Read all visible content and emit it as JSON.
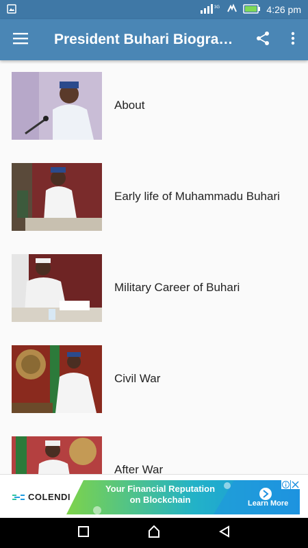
{
  "status_bar": {
    "time": "4:26 pm",
    "network": "3G",
    "icons": [
      "image-icon",
      "signal-icon",
      "charging-icon",
      "battery-icon"
    ]
  },
  "app_bar": {
    "title": "President Buhari Biograp...",
    "icons": [
      "menu-icon",
      "share-icon",
      "more-vert-icon"
    ]
  },
  "list": {
    "items": [
      {
        "label": "About"
      },
      {
        "label": "Early life of Muhammadu Buhari"
      },
      {
        "label": "Military Career of Buhari"
      },
      {
        "label": "Civil War"
      },
      {
        "label": "After War"
      }
    ]
  },
  "ad": {
    "brand": "COLENDI",
    "headline_line1": "Your Financial Reputation",
    "headline_line2": "on Blockchain",
    "cta": "Learn More",
    "colors": {
      "green": "#6fcf3a",
      "blue": "#1e9be0",
      "navy": "#0b2a5b"
    }
  },
  "nav_bar": {
    "icons": [
      "recents-square-icon",
      "home-icon",
      "back-triangle-icon"
    ]
  },
  "colors": {
    "status_bar": "#3f78a6",
    "app_bar": "#4a86b5",
    "background": "#fafafa"
  }
}
